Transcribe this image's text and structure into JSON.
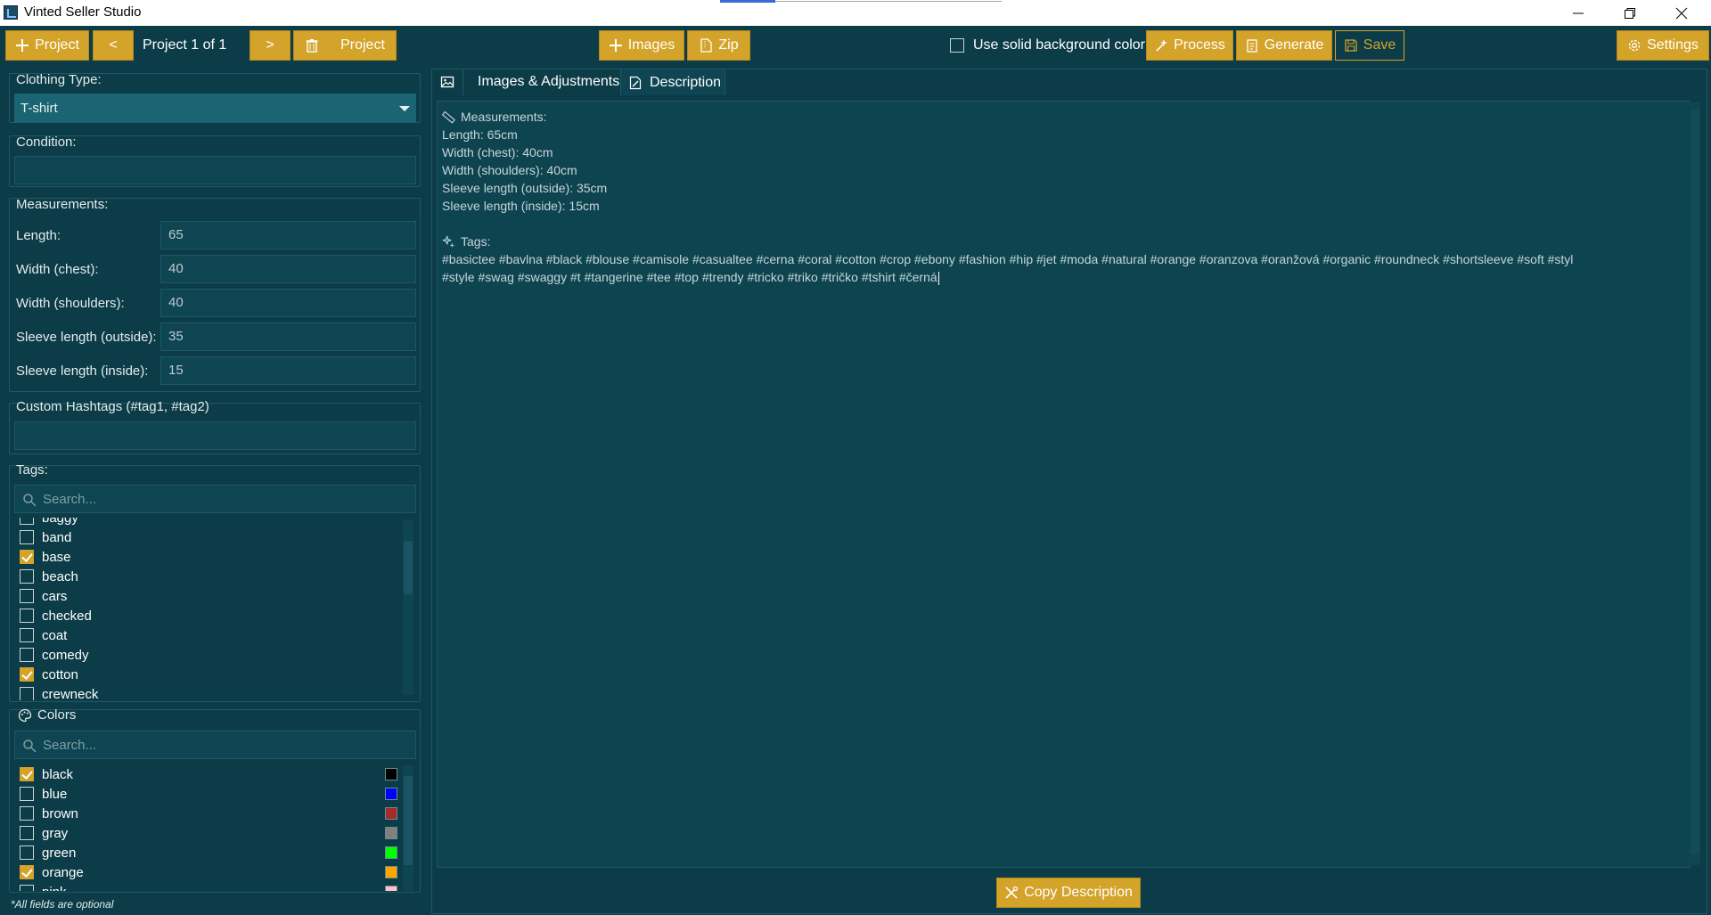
{
  "window": {
    "title": "Vinted Seller Studio"
  },
  "toolbar": {
    "new_project": "Project",
    "prev": "<",
    "counter": "Project 1 of 1",
    "next": ">",
    "delete_project": "Project",
    "add_images": "Images",
    "zip": "Zip",
    "solid_bg_label": "Use solid background color",
    "solid_bg_checked": false,
    "process": "Process",
    "generate": "Generate",
    "save": "Save",
    "settings": "Settings"
  },
  "left": {
    "clothing_type_label": "Clothing Type:",
    "clothing_type_value": "T-shirt",
    "condition_label": "Condition:",
    "condition_value": "",
    "measurements_label": "Measurements:",
    "measurements": [
      {
        "label": "Length:",
        "value": "65"
      },
      {
        "label": "Width (chest):",
        "value": "40"
      },
      {
        "label": "Width (shoulders):",
        "value": "40"
      },
      {
        "label": "Sleeve length (outside):",
        "value": "35"
      },
      {
        "label": "Sleeve length (inside):",
        "value": "15"
      }
    ],
    "hashtags_label": "Custom Hashtags (#tag1, #tag2)",
    "hashtags_value": "",
    "tags_label": "Tags:",
    "tags_search_placeholder": "Search...",
    "tags": [
      {
        "name": "baggy",
        "checked": false
      },
      {
        "name": "band",
        "checked": false
      },
      {
        "name": "base",
        "checked": true
      },
      {
        "name": "beach",
        "checked": false
      },
      {
        "name": "cars",
        "checked": false
      },
      {
        "name": "checked",
        "checked": false
      },
      {
        "name": "coat",
        "checked": false
      },
      {
        "name": "comedy",
        "checked": false
      },
      {
        "name": "cotton",
        "checked": true
      },
      {
        "name": "crewneck",
        "checked": false
      }
    ],
    "colors_label": "Colors",
    "colors_search_placeholder": "Search...",
    "colors": [
      {
        "name": "black",
        "checked": true,
        "swatch": "#000000"
      },
      {
        "name": "blue",
        "checked": false,
        "swatch": "#0000ff"
      },
      {
        "name": "brown",
        "checked": false,
        "swatch": "#a52a2a"
      },
      {
        "name": "gray",
        "checked": false,
        "swatch": "#808080"
      },
      {
        "name": "green",
        "checked": false,
        "swatch": "#00ff00"
      },
      {
        "name": "orange",
        "checked": true,
        "swatch": "#ffa500"
      },
      {
        "name": "pink",
        "checked": false,
        "swatch": "#ffc0cb"
      }
    ],
    "footer_note": "*All fields are optional"
  },
  "tabs": [
    {
      "label": "Images & Adjustments"
    },
    {
      "label": "Description"
    }
  ],
  "description": {
    "measurements_heading": "Measurements:",
    "lines": [
      "Length: 65cm",
      "Width (chest): 40cm",
      "Width (shoulders): 40cm",
      "Sleeve length (outside): 35cm",
      "Sleeve length (inside): 15cm"
    ],
    "tags_heading": "Tags:",
    "tags_line1": "#basictee #bavlna #black #blouse #camisole #casualtee #cerna #coral #cotton #crop #ebony #fashion #hip #jet #moda #natural #orange #oranzova #oranžová #organic #roundneck #shortsleeve #soft #styl",
    "tags_line2": "#style #swag #swaggy #t #tangerine #tee #top #trendy #tricko #triko #tričko #tshirt #černá"
  },
  "copy_button": "Copy Description",
  "colors_theme": {
    "accent": "#d4a32a",
    "background": "#0c3c47",
    "panel": "#0e4450"
  }
}
